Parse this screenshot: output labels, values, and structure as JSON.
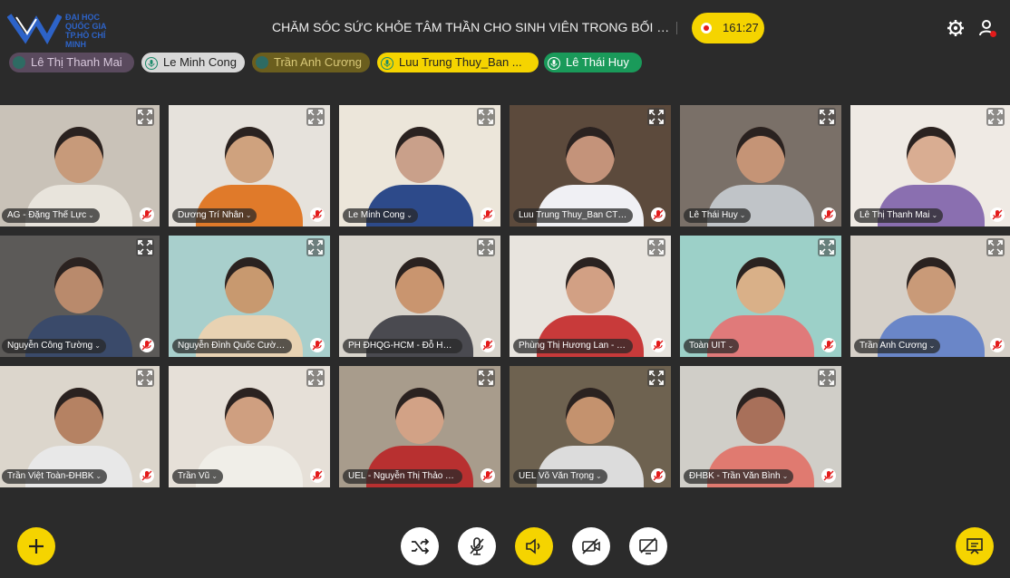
{
  "header": {
    "logo_text": "ĐẠI HỌC QUỐC GIA TP.HỒ CHÍ MINH",
    "title": "CHĂM SÓC SỨC KHỎE TÂM THẦN CHO SINH VIÊN TRONG BỐI CẢNH P...",
    "timer": "161:27"
  },
  "speakers": [
    {
      "name": "Lê Thị Thanh Mai",
      "bg": "#5a4a5e",
      "color": "#d8c8dc",
      "icon": "dot-icon",
      "icon_color": "#2e6b63"
    },
    {
      "name": "Le Minh Cong",
      "bg": "#d8d8d8",
      "color": "#222222",
      "icon": "mic-icon",
      "icon_color": "#1a8a6a"
    },
    {
      "name": "Trần Anh Cương",
      "bg": "#6b5e1e",
      "color": "#d9c979",
      "icon": "dot-icon",
      "icon_color": "#2e6b63"
    },
    {
      "name": "Luu Trung Thuy_Ban ...",
      "bg": "#f5d400",
      "color": "#222222",
      "icon": "mic-icon",
      "icon_color": "#1a8a6a"
    },
    {
      "name": "Lê Thái Huy",
      "bg": "#1a9a5a",
      "color": "#ffffff",
      "icon": "mic-icon",
      "icon_color": "#ffffff"
    }
  ],
  "participants": [
    {
      "name": "AG - Đặng Thế Lực",
      "bg": "#c9c2b8",
      "skin": "#c79a7a",
      "shirt": "#e8e4dc"
    },
    {
      "name": "Dương Trí Nhân",
      "bg": "#e6e2dc",
      "skin": "#cfa27e",
      "shirt": "#e07a2a"
    },
    {
      "name": "Le Minh Cong",
      "bg": "#ece6da",
      "skin": "#c9a08a",
      "shirt": "#2d4a8a"
    },
    {
      "name": "Luu Trung Thuy_Ban CTSV",
      "bg": "#5c4a3c",
      "skin": "#c4937a",
      "shirt": "#f0f0f4"
    },
    {
      "name": "Lê Thái Huy",
      "bg": "#7a7068",
      "skin": "#c59476",
      "shirt": "#c0c4c8"
    },
    {
      "name": "Lê Thị Thanh Mai",
      "bg": "#efeae4",
      "skin": "#d9ad92",
      "shirt": "#8a6fb0"
    },
    {
      "name": "Nguyễn Công Tường",
      "bg": "#5c5a58",
      "skin": "#b98a6c",
      "shirt": "#3a4a6a"
    },
    {
      "name": "Nguyễn Đình Quốc Cường",
      "bg": "#a8cfcc",
      "skin": "#c8996f",
      "shirt": "#e8d2b2"
    },
    {
      "name": "PH ĐHQG-HCM - Đỗ Hoàng...",
      "bg": "#d8d4cc",
      "skin": "#c9956f",
      "shirt": "#4a4a50"
    },
    {
      "name": "Phùng Thị Hương Lan - TT...",
      "bg": "#e8e4de",
      "skin": "#d2a084",
      "shirt": "#c83a3a"
    },
    {
      "name": "Toàn UIT",
      "bg": "#9cd0c8",
      "skin": "#d9b088",
      "shirt": "#e07a7a"
    },
    {
      "name": "Trần Anh Cương",
      "bg": "#d6d0c8",
      "skin": "#c99a78",
      "shirt": "#6a86c8"
    },
    {
      "name": "Trần Việt Toàn-ĐHBK",
      "bg": "#dcd6cc",
      "skin": "#b58263",
      "shirt": "#e8e8e8"
    },
    {
      "name": "Trần Vũ",
      "bg": "#e6e0d8",
      "skin": "#cf9f80",
      "shirt": "#f0eee8"
    },
    {
      "name": "UEL - Nguyễn Thị Thảo Tr...",
      "bg": "#a89c8c",
      "skin": "#d2a286",
      "shirt": "#b83030"
    },
    {
      "name": "UEL Võ Văn Trọng",
      "bg": "#6e6250",
      "skin": "#c4926e",
      "shirt": "#dcdcdc"
    },
    {
      "name": "ĐHBK - Trần Văn Bình",
      "bg": "#d0cec8",
      "skin": "#a8705a",
      "shirt": "#e07a70"
    }
  ],
  "controls": {
    "add": "plus-icon",
    "shuffle": "shuffle-icon",
    "mic": "mic-off-icon",
    "speaker": "speaker-icon",
    "camera": "camera-off-icon",
    "share": "screen-share-off-icon",
    "chat": "chat-icon"
  }
}
